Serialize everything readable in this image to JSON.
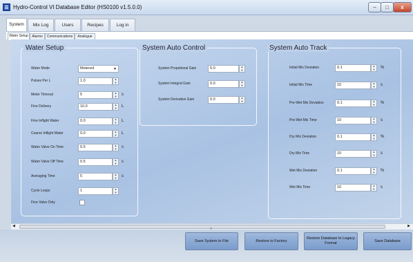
{
  "window": {
    "title": "Hydro-Control VI Database Editor (HS0100 v1.5.0.0)",
    "buttons": {
      "minimize": "–",
      "maximize": "□",
      "close": "x"
    }
  },
  "main_tabs": [
    "System",
    "Mix Log",
    "Users",
    "Recipes",
    "Log in"
  ],
  "sub_tabs": [
    "Water Setup",
    "Alarms",
    "Communications",
    "Analogue"
  ],
  "water_setup": {
    "title": "Water Setup",
    "rows": [
      {
        "label": "Water Mode",
        "value": "Metered",
        "unit": "",
        "kind": "dropdown"
      },
      {
        "label": "Pulses Per  L",
        "value": "1.0",
        "unit": "",
        "kind": "spin"
      },
      {
        "label": "Meter Timeout",
        "value": "5",
        "unit": "s",
        "kind": "spin"
      },
      {
        "label": "Fine Delivery",
        "value": "10.0",
        "unit": "L",
        "kind": "spin"
      },
      {
        "label": "Fine Inflight Water",
        "value": "0.0",
        "unit": "L",
        "kind": "spin"
      },
      {
        "label": "Coarse Inflight Water",
        "value": "0.0",
        "unit": "L",
        "kind": "spin"
      },
      {
        "label": "Water Valve On Time",
        "value": "0.5",
        "unit": "s",
        "kind": "spin"
      },
      {
        "label": "Water Valve Off Time",
        "value": "0.5",
        "unit": "s",
        "kind": "spin"
      },
      {
        "label": "Averaging Time",
        "value": "5",
        "unit": "s",
        "kind": "spin"
      },
      {
        "label": "Cycle Loops",
        "value": "1",
        "unit": "",
        "kind": "spin"
      },
      {
        "label": "Fine Valve Only",
        "value": "",
        "unit": "",
        "kind": "checkbox"
      }
    ]
  },
  "auto_control": {
    "title": "System Auto Control",
    "rows": [
      {
        "label": "System Propotional Gain",
        "value": "5.0"
      },
      {
        "label": "System Integral Gain",
        "value": "0.0"
      },
      {
        "label": "System Derivative Gain",
        "value": "0.0"
      }
    ]
  },
  "auto_track": {
    "title": "System Auto Track",
    "rows": [
      {
        "label": "Initial Mix Deviation",
        "value": "0.1",
        "unit": "%"
      },
      {
        "label": "Initial Mix Time",
        "value": "10",
        "unit": "s"
      },
      {
        "label": "Pre-Wet Mix Deviation",
        "value": "0.1",
        "unit": "%"
      },
      {
        "label": "Pre-Wet Mix Time",
        "value": "10",
        "unit": "s"
      },
      {
        "label": "Dry Mix Deviation",
        "value": "0.1",
        "unit": "%"
      },
      {
        "label": "Dry Mix Time",
        "value": "10",
        "unit": "s"
      },
      {
        "label": "Wet Mix Deviation",
        "value": "0.1",
        "unit": "%"
      },
      {
        "label": "Wet Mix Time",
        "value": "10",
        "unit": "s"
      }
    ]
  },
  "buttons": {
    "save_system": "Save System to File",
    "restore_factory": "Restore to Factory",
    "restore_legacy": "Restore Database to Legacy Format",
    "save_database": "Save Database"
  },
  "scrollbar": {
    "left_arrow": "◀",
    "right_arrow": "▶",
    "grip": "|||"
  },
  "colors": {
    "accent": "#2a56b8",
    "button": "#8aa8d4",
    "content_bg": "#b7cce8"
  }
}
